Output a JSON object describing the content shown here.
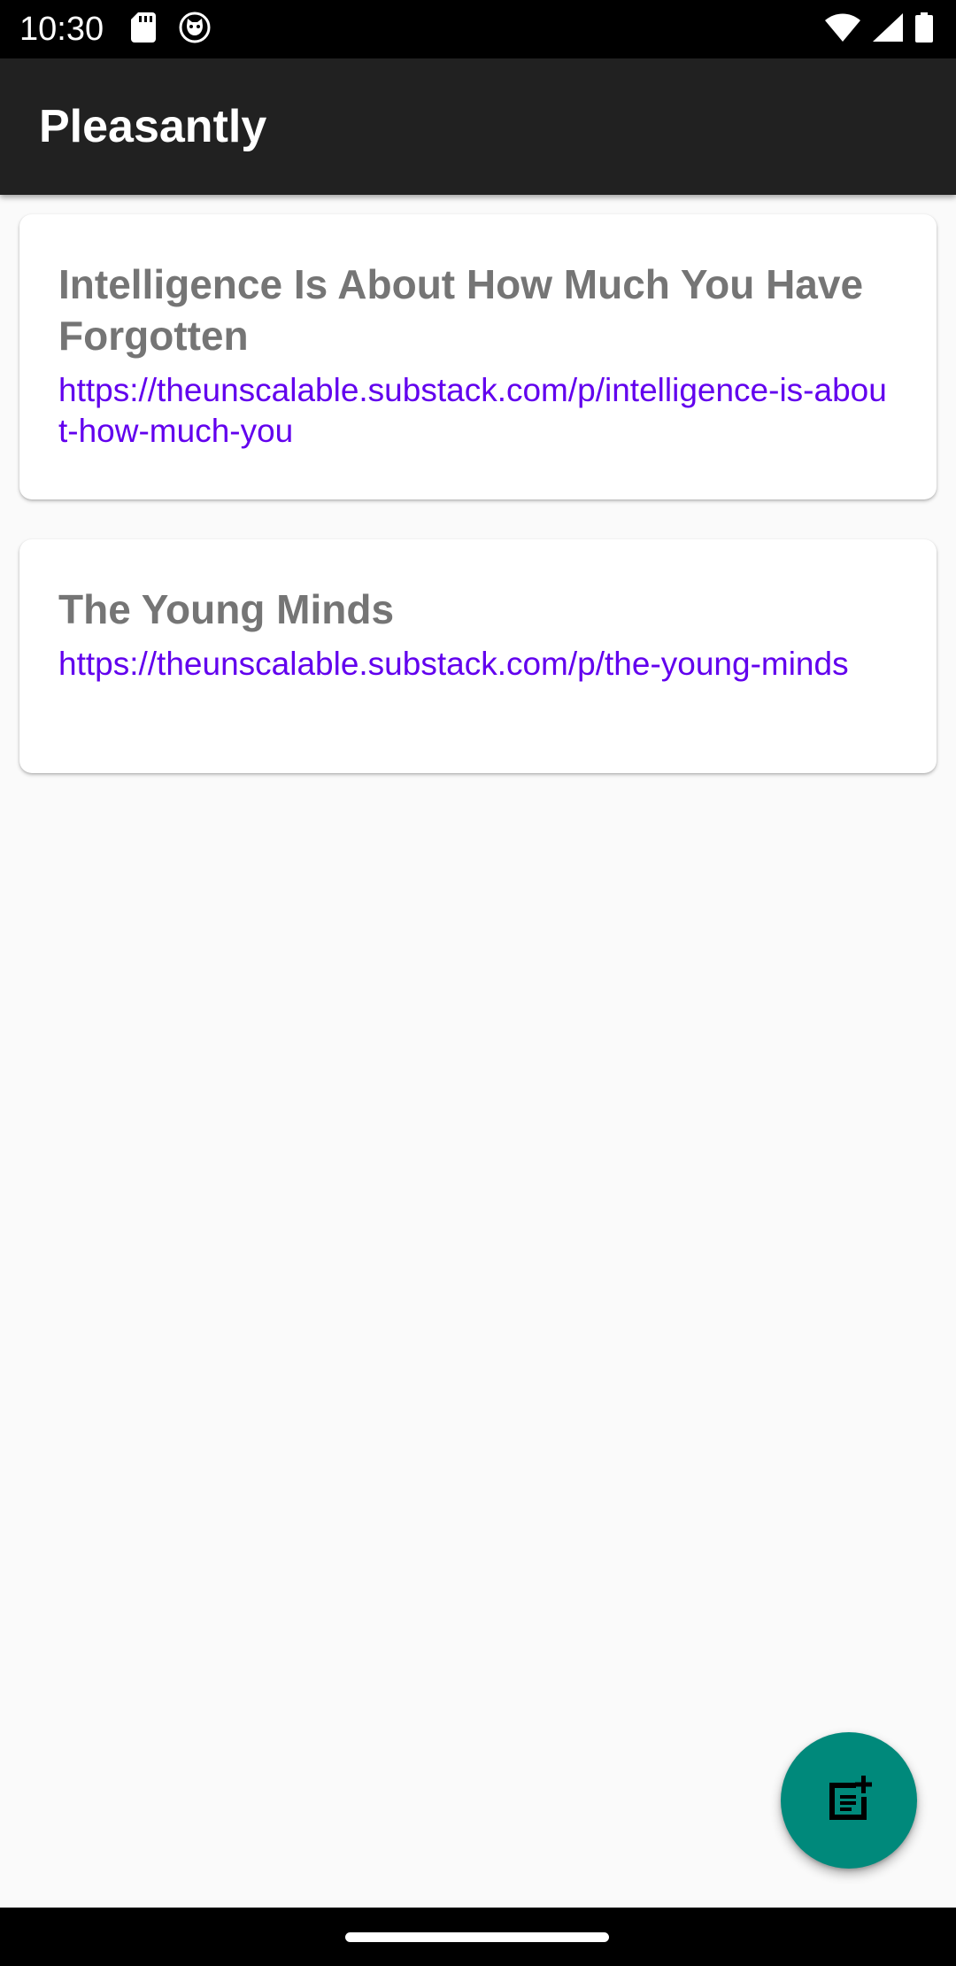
{
  "status_bar": {
    "time": "10:30",
    "left_icons": [
      "sd-card-icon",
      "cat-face-icon"
    ],
    "right_icons": [
      "wifi-icon",
      "cellular-signal-icon",
      "battery-icon"
    ]
  },
  "app_bar": {
    "title": "Pleasantly"
  },
  "cards": [
    {
      "title": "Intelligence Is About How Much You Have Forgotten",
      "link": "https://theunscalable.substack.com/p/intelligence-is-about-how-much-you"
    },
    {
      "title": "The Young Minds",
      "link": "https://theunscalable.substack.com/p/the-young-minds"
    }
  ],
  "fab": {
    "icon": "note-add-icon"
  },
  "colors": {
    "status_bar": "#000000",
    "app_bar": "#212121",
    "background": "#FAFAFA",
    "card_title": "#757575",
    "link": "#6200EE",
    "fab": "#00897B"
  }
}
